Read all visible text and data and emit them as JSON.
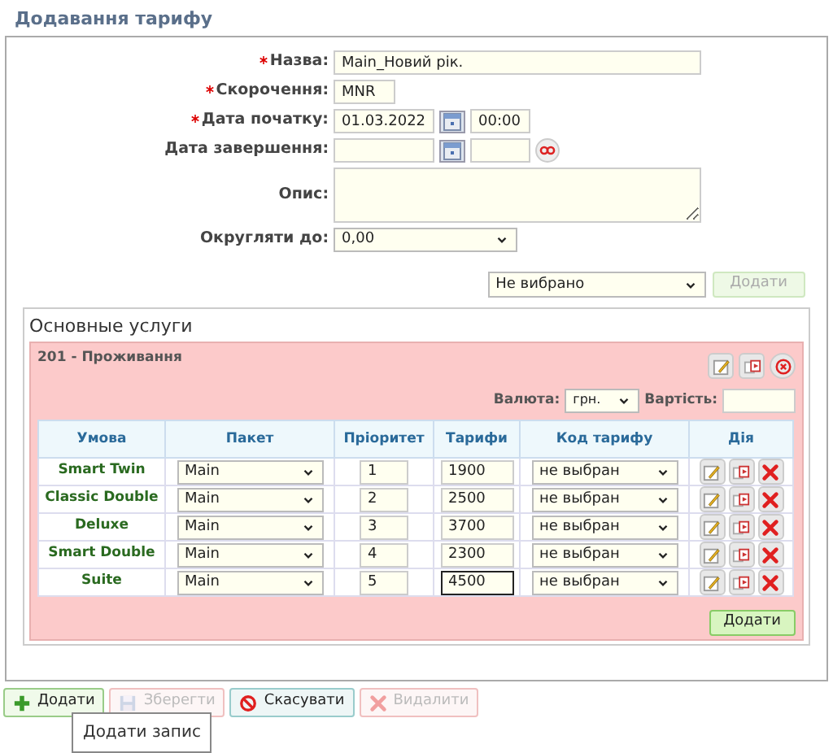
{
  "title": "Додавання тарифу",
  "fields": [
    {
      "kind": "long_text",
      "label": "Назва:",
      "required": true,
      "value": "Main_Новий рік."
    },
    {
      "kind": "short_text",
      "label": "Скорочення:",
      "required": true,
      "value": "MNR"
    },
    {
      "kind": "date",
      "label": "Дата початку:",
      "required": true,
      "date": "01.03.2022",
      "time": "00:00",
      "clear": false
    },
    {
      "kind": "date",
      "label": "Дата завершення:",
      "required": false,
      "clear": true
    },
    {
      "kind": "textarea",
      "label": "Опис:",
      "required": false
    },
    {
      "kind": "select",
      "label": "Округляти до:",
      "required": false,
      "value": "0,00"
    }
  ],
  "service_picker": {
    "value": "Не вибрано",
    "button": {
      "label": "Додати",
      "disabled": true
    }
  },
  "section": {
    "title": "Основные услуги",
    "group": "201 - Проживання",
    "currency_label": "Валюта:",
    "currency": "грн.",
    "cost_label": "Вартість:",
    "columns": [
      "Умова",
      "Пакет",
      "Пріоритет",
      "Тарифи",
      "Код тарифу",
      "Дія"
    ],
    "rows": [
      {
        "condition": "Smart Twin",
        "package": "Main",
        "priority": "1",
        "tariff": "1900",
        "code": "не выбран",
        "focused": false
      },
      {
        "condition": "Classic Double",
        "package": "Main",
        "priority": "2",
        "tariff": "2500",
        "code": "не выбран",
        "focused": false
      },
      {
        "condition": "Deluxe",
        "package": "Main",
        "priority": "3",
        "tariff": "3700",
        "code": "не выбран",
        "focused": false
      },
      {
        "condition": "Smart Double",
        "package": "Main",
        "priority": "4",
        "tariff": "2300",
        "code": "не выбран",
        "focused": false
      },
      {
        "condition": "Suite",
        "package": "Main",
        "priority": "5",
        "tariff": "4500",
        "code": "не выбран",
        "focused": true
      }
    ],
    "add_button": "Додати"
  },
  "buttons": [
    {
      "kind": "add",
      "label": "Додати",
      "disabled": false
    },
    {
      "kind": "save",
      "label": "Зберегти",
      "disabled": true
    },
    {
      "kind": "cancel",
      "label": "Скасувати",
      "disabled": false
    },
    {
      "kind": "delete",
      "label": "Видалити",
      "disabled": true
    }
  ],
  "tooltip": "Додати запис"
}
